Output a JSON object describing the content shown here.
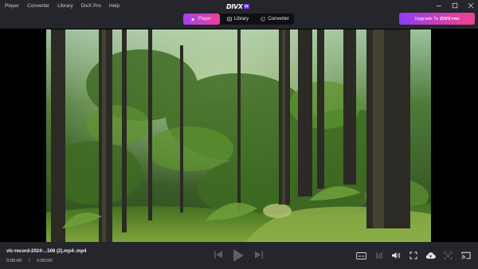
{
  "menu": [
    "Player",
    "Converter",
    "Library",
    "DivX Pro",
    "Help"
  ],
  "logo": {
    "text": "DIVX",
    "badge": "11"
  },
  "tabs": [
    {
      "label": "Player",
      "active": true
    },
    {
      "label": "Library",
      "active": false
    },
    {
      "label": "Converter",
      "active": false
    }
  ],
  "upgrade": {
    "prefix": "Upgrade To",
    "brand": "DIVX",
    "badge": "PRO"
  },
  "player": {
    "filename": "vlc-record-2024-...506 (2).mp4-.mp4",
    "current_time": "0:00:00",
    "separator": "/",
    "total_time": "0:00:00"
  },
  "icons": {
    "prev": "skip-previous-icon",
    "play": "play-icon",
    "next": "skip-next-icon",
    "subtitles": "subtitles-icon",
    "equalizer": "equalizer-icon",
    "volume": "volume-icon",
    "fullscreen": "fullscreen-icon",
    "cloud": "cloud-upload-icon",
    "screenshot": "snapshot-icon",
    "cast": "cast-icon"
  },
  "colors": {
    "accent_start": "#a23ff0",
    "accent_end": "#ef3f9a",
    "titlebar": "#25262c",
    "video_bg": "#000000"
  }
}
